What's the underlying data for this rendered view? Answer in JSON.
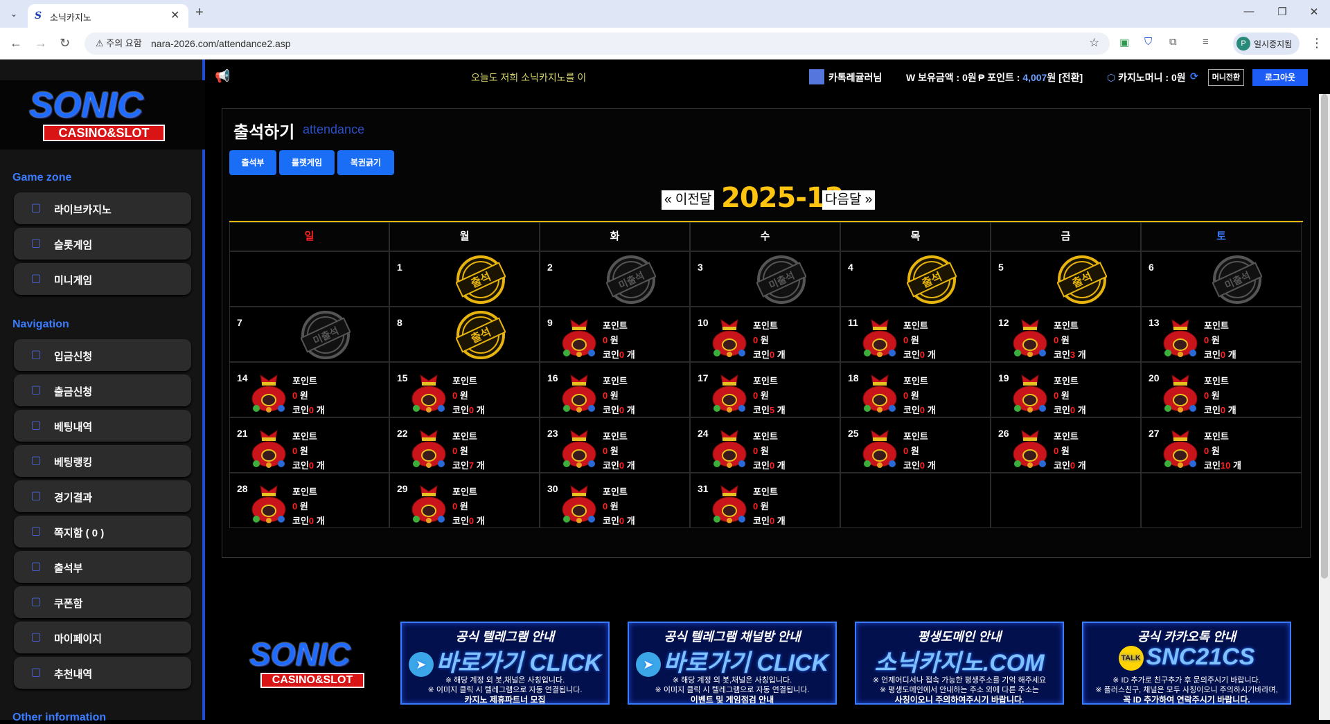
{
  "browser": {
    "tab_title": "소닉카지노",
    "tab_favicon": "S",
    "security_label": "⚠ 주의 요함",
    "url": "nara-2026.com/attendance2.asp",
    "profile_initial": "P",
    "profile_name": "일시중지됨"
  },
  "sidebar": {
    "logo_main": "SONIC",
    "logo_sub": "CASINO&SLOT",
    "sections": [
      {
        "title": "Game zone"
      },
      {
        "title": "Navigation"
      },
      {
        "title": "Other information"
      }
    ],
    "game_items": [
      {
        "label": "라이브카지노",
        "icon": "card-icon"
      },
      {
        "label": "슬롯게임",
        "icon": "slot-icon"
      },
      {
        "label": "미니게임",
        "icon": "list-icon"
      }
    ],
    "nav_items": [
      {
        "label": "입금신청",
        "icon": "deposit-icon"
      },
      {
        "label": "출금신청",
        "icon": "withdraw-icon"
      },
      {
        "label": "베팅내역",
        "icon": "history-icon"
      },
      {
        "label": "베팅랭킹",
        "icon": "ranking-icon"
      },
      {
        "label": "경기결과",
        "icon": "trophy-icon"
      },
      {
        "label": "쪽지함 ( 0 )",
        "icon": "message-icon"
      },
      {
        "label": "출석부",
        "icon": "calendar-icon"
      },
      {
        "label": "쿠폰함",
        "icon": "coupon-icon"
      },
      {
        "label": "마이페이지",
        "icon": "gear-icon"
      },
      {
        "label": "추천내역",
        "icon": "user-add-icon"
      }
    ]
  },
  "topbar": {
    "marquee": "오늘도 저희 소닉카지노를 이",
    "user_name": "카톡레귤러님",
    "balance_label": "W 보유금액 : ",
    "balance_value": "0원",
    "points_label": "₱ 포인트 : ",
    "points_value": "4,007",
    "points_suffix": "원 [전환]",
    "casino_label": "카지노머니 : ",
    "casino_value": "0원",
    "money_btn": "머니전환",
    "logout_btn": "로그아웃"
  },
  "attendance": {
    "title": "출석하기",
    "subtitle": "attendance",
    "tabs": [
      "출석부",
      "룰렛게임",
      "복권긁기"
    ],
    "prev": "« 이전달",
    "month": "2025-12",
    "next": "다음달 »",
    "weekdays": [
      "일",
      "월",
      "화",
      "수",
      "목",
      "금",
      "토"
    ],
    "weekday_colors": [
      "#ff2020",
      "#ffffff",
      "#ffffff",
      "#ffffff",
      "#ffffff",
      "#ffffff",
      "#3a7bff"
    ],
    "stamp_present": "출석",
    "stamp_absent": "미출석",
    "point_label": "포인트",
    "won_suffix": "원",
    "coin_label": "코인",
    "coin_suffix": " 개",
    "days": [
      {
        "d": "1",
        "status": "present"
      },
      {
        "d": "2",
        "status": "absent"
      },
      {
        "d": "3",
        "status": "absent"
      },
      {
        "d": "4",
        "status": "present"
      },
      {
        "d": "5",
        "status": "present"
      },
      {
        "d": "6",
        "status": "absent"
      },
      {
        "d": "7",
        "status": "absent"
      },
      {
        "d": "8",
        "status": "present"
      },
      {
        "d": "9",
        "status": "reward",
        "point": "0",
        "coin": "0"
      },
      {
        "d": "10",
        "status": "reward",
        "point": "0",
        "coin": "0"
      },
      {
        "d": "11",
        "status": "reward",
        "point": "0",
        "coin": "0"
      },
      {
        "d": "12",
        "status": "reward",
        "point": "0",
        "coin": "3"
      },
      {
        "d": "13",
        "status": "reward",
        "point": "0",
        "coin": "0"
      },
      {
        "d": "14",
        "status": "reward",
        "point": "0",
        "coin": "0"
      },
      {
        "d": "15",
        "status": "reward",
        "point": "0",
        "coin": "0"
      },
      {
        "d": "16",
        "status": "reward",
        "point": "0",
        "coin": "0"
      },
      {
        "d": "17",
        "status": "reward",
        "point": "0",
        "coin": "5"
      },
      {
        "d": "18",
        "status": "reward",
        "point": "0",
        "coin": "0"
      },
      {
        "d": "19",
        "status": "reward",
        "point": "0",
        "coin": "0"
      },
      {
        "d": "20",
        "status": "reward",
        "point": "0",
        "coin": "0"
      },
      {
        "d": "21",
        "status": "reward",
        "point": "0",
        "coin": "0"
      },
      {
        "d": "22",
        "status": "reward",
        "point": "0",
        "coin": "7"
      },
      {
        "d": "23",
        "status": "reward",
        "point": "0",
        "coin": "0"
      },
      {
        "d": "24",
        "status": "reward",
        "point": "0",
        "coin": "0"
      },
      {
        "d": "25",
        "status": "reward",
        "point": "0",
        "coin": "0"
      },
      {
        "d": "26",
        "status": "reward",
        "point": "0",
        "coin": "0"
      },
      {
        "d": "27",
        "status": "reward",
        "point": "0",
        "coin": "10"
      },
      {
        "d": "28",
        "status": "reward",
        "point": "0",
        "coin": "0"
      },
      {
        "d": "29",
        "status": "reward",
        "point": "0",
        "coin": "0"
      },
      {
        "d": "30",
        "status": "reward",
        "point": "0",
        "coin": "0"
      },
      {
        "d": "31",
        "status": "reward",
        "point": "0",
        "coin": "0"
      }
    ]
  },
  "banners": [
    {
      "title": "공식 텔레그램 안내",
      "main": "바로가기 CLICK",
      "icon": "telegram-icon",
      "l1": "※ 해당 계정 외 봇,채널은 사칭입니다.",
      "l2": "※ 이미지 클릭 시 텔레그램으로 자동 연결됩니다.",
      "l3": "카지노 제휴파트너 모집"
    },
    {
      "title": "공식 텔레그램 채널방 안내",
      "main": "바로가기 CLICK",
      "icon": "telegram-icon",
      "l1": "※ 해당 계정 외 봇,채널은 사칭입니다.",
      "l2": "※ 이미지 클릭 시 텔레그램으로 자동 연결됩니다.",
      "l3": "이벤트 및 게임점검 안내"
    },
    {
      "title": "평생도메인 안내",
      "main": "소닉카지노.COM",
      "icon": "",
      "l1": "※ 언제어디서나 접속 가능한 평생주소를 기억 해주세요",
      "l2": "※ 평생도메인에서 안내하는 주소 외에 다른 주소는",
      "l3": "사칭이오니 주의하여주시기 바랍니다."
    },
    {
      "title": "공식 카카오톡 안내",
      "main": "SNC21CS",
      "icon": "kakao-icon",
      "icon_text": "TALK",
      "l1": "※ ID 추가로 친구추가 후 문의주시기 바랍니다.",
      "l2": "※ 플러스친구, 채널은 모두 사칭이오니 주의하시기바라며,",
      "l3": "꼭 ID 추가하여 연락주시기 바랍니다."
    }
  ],
  "colors": {
    "accent": "#1e4ed6",
    "gold": "#ffc40f",
    "red": "#ff2020"
  }
}
